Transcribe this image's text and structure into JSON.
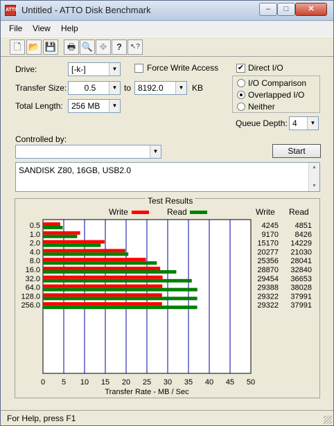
{
  "window": {
    "title": "Untitled - ATTO Disk Benchmark"
  },
  "title_buttons": {
    "minimize": "–",
    "maximize": "□",
    "close": "✕"
  },
  "menu": [
    {
      "label": "File"
    },
    {
      "label": "View"
    },
    {
      "label": "Help"
    }
  ],
  "toolbar": [
    {
      "icon": "new-document-icon",
      "glyph": "🗋"
    },
    {
      "icon": "open-folder-icon",
      "glyph": "📂"
    },
    {
      "icon": "save-icon",
      "glyph": "💾"
    },
    {
      "icon": "print-icon",
      "glyph": "🖶"
    },
    {
      "icon": "print-preview-icon",
      "glyph": "🔍"
    },
    {
      "icon": "move-icon",
      "glyph": "✥"
    },
    {
      "icon": "help-icon",
      "glyph": "?"
    },
    {
      "icon": "context-help-icon",
      "glyph": "↖?"
    }
  ],
  "settings": {
    "drive_label": "Drive:",
    "drive_value": "[-k-]",
    "force_write_label": "Force Write Access",
    "force_write_checked": false,
    "direct_io_label": "Direct I/O",
    "direct_io_checked": true,
    "transfer_size_label": "Transfer Size:",
    "transfer_from": "0.5",
    "to_label": "to",
    "transfer_to": "8192.0",
    "kb_label": "KB",
    "total_length_label": "Total Length:",
    "total_length_value": "256 MB",
    "io_options": [
      {
        "label": "I/O Comparison",
        "selected": false
      },
      {
        "label": "Overlapped I/O",
        "selected": true
      },
      {
        "label": "Neither",
        "selected": false
      }
    ],
    "queue_depth_label": "Queue Depth:",
    "queue_depth_value": "4",
    "controlled_by_label": "Controlled by:",
    "controlled_by_value": "",
    "start_label": "Start",
    "description": "SANDISK Z80, 16GB, USB2.0"
  },
  "results": {
    "title": "Test Results",
    "write_legend": "Write",
    "read_legend": "Read",
    "write_header": "Write",
    "read_header": "Read"
  },
  "chart_data": {
    "type": "bar",
    "orientation": "horizontal",
    "title": "Test Results",
    "xlabel": "Transfer Rate - MB / Sec",
    "ylabel": "",
    "xlim": [
      0,
      50
    ],
    "x_ticks": [
      "0",
      "5",
      "10",
      "15",
      "20",
      "25",
      "30",
      "35",
      "40",
      "45",
      "50"
    ],
    "categories": [
      "0.5",
      "1.0",
      "2.0",
      "4.0",
      "8.0",
      "16.0",
      "32.0",
      "64.0",
      "128.0",
      "256.0"
    ],
    "series": [
      {
        "name": "Write",
        "color": "#ff0000",
        "values": [
          4245,
          9170,
          15170,
          20277,
          25356,
          28870,
          29454,
          29388,
          29322,
          29322
        ]
      },
      {
        "name": "Read",
        "color": "#008000",
        "values": [
          4851,
          8426,
          14229,
          21030,
          28041,
          32840,
          36653,
          38028,
          37991,
          37991
        ]
      }
    ],
    "units_note": "values in KB/sec; axis shown in MB/sec",
    "grid": true,
    "grid_color": "#0000a0",
    "legend_position": "top"
  },
  "status": {
    "text": "For Help, press F1"
  }
}
